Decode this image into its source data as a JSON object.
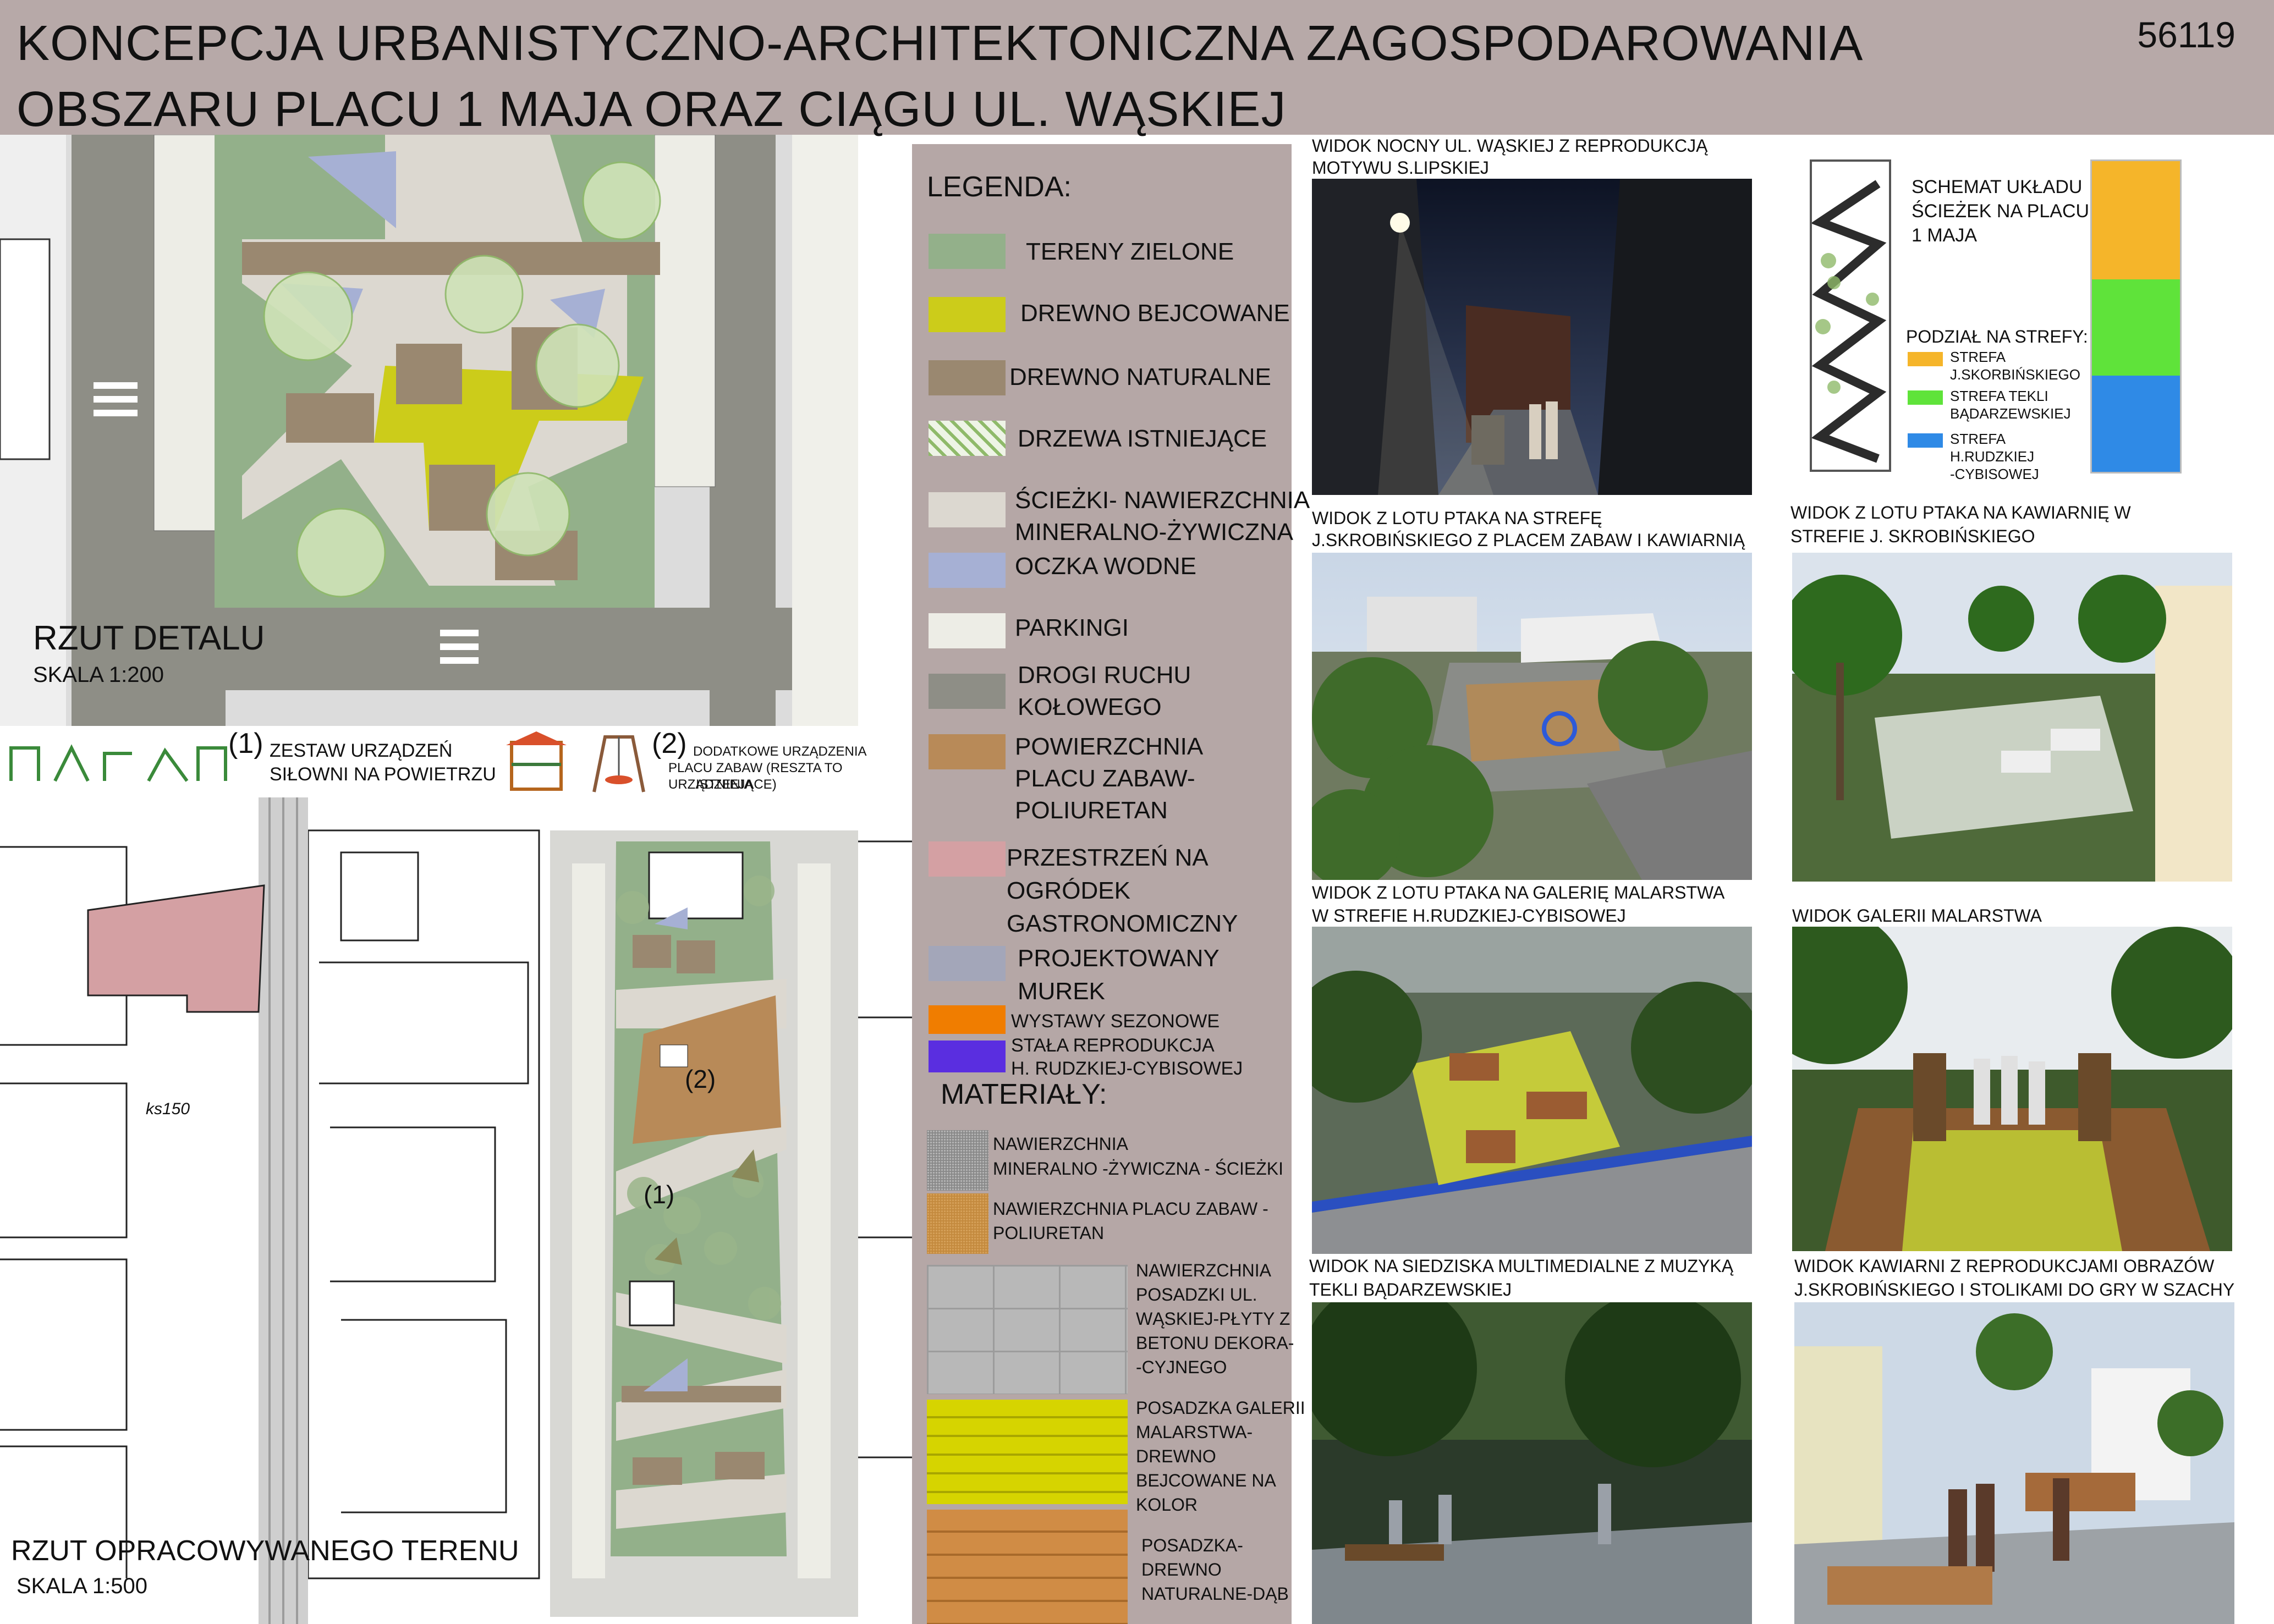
{
  "header": {
    "title_line1": "KONCEPCJA URBANISTYCZNO-ARCHITEKTONICZNA ZAGOSPODAROWANIA",
    "title_line2": "OBSZARU PLACU 1 MAJA ORAZ CIĄGU UL. WĄSKIEJ",
    "sheet_number": "56119"
  },
  "detail_plan": {
    "title": "RZUT DETALU",
    "scale": "SKALA 1:200"
  },
  "site_plan": {
    "title": "RZUT OPRACOWYWANEGO TERENU",
    "scale": "SKALA 1:500",
    "label_ks": "ks150"
  },
  "equipment": {
    "item1_num": "(1)",
    "item1_text_a": "ZESTAW URZĄDZEŃ",
    "item1_text_b": "SIŁOWNI NA POWIETRZU",
    "item2_num": "(2)",
    "item2_text_a": "DODATKOWE URZĄDZENIA",
    "item2_text_b": "PLACU ZABAW (RESZTA TO URZĄDZENIA",
    "item2_text_c": "ISTNIEJĄCE)"
  },
  "plan_markers": {
    "m1": "(1)",
    "m2": "(2)"
  },
  "legend": {
    "title": "LEGENDA:",
    "items": [
      {
        "label": "TERENY ZIELONE",
        "color": "#93b08a"
      },
      {
        "label": "DREWNO BEJCOWANE",
        "color": "#cccc1a"
      },
      {
        "label": "DREWNO NATURALNE",
        "color": "#9a8870"
      },
      {
        "label": "DRZEWA ISTNIEJĄCE",
        "color": "#8fba6a"
      },
      {
        "label": "ŚCIEŻKI- NAWIERZCHNIA",
        "label2": "MINERALNO-ŻYWICZNA",
        "color": "#dcd8d0"
      },
      {
        "label": "OCZKA WODNE",
        "color": "#a6b0d4"
      },
      {
        "label": "PARKINGI",
        "color": "#ededE6"
      },
      {
        "label": "DROGI RUCHU",
        "label2": "KOŁOWEGO",
        "color": "#8e8e86"
      },
      {
        "label": "POWIERZCHNIA",
        "label2": "PLACU ZABAW-",
        "label3": "POLIURETAN",
        "color": "#b88a58"
      },
      {
        "label": "PRZESTRZEŃ NA",
        "label2": "OGRÓDEK",
        "label3": "GASTRONOMICZNY",
        "color": "#d4a0a3"
      },
      {
        "label": "PROJEKTOWANY",
        "label2": "MUREK",
        "color": "#a3a6b9"
      },
      {
        "label": "WYSTAWY SEZONOWE",
        "color": "#f07d00"
      },
      {
        "label": "STAŁA REPRODUKCJA",
        "label2": "H. RUDZKIEJ-CYBISOWEJ",
        "color": "#5a2ee0"
      }
    ]
  },
  "materials": {
    "title": "MATERIAŁY:",
    "items": [
      {
        "label": "NAWIERZCHNIA",
        "label2": "MINERALNO -ŻYWICZNA - ŚCIEŻKI"
      },
      {
        "label": "NAWIERZCHNIA PLACU ZABAW -",
        "label2": "POLIURETAN"
      },
      {
        "label": "NAWIERZCHNIA",
        "label2": "POSADZKI UL.",
        "label3": "WĄSKIEJ-PŁYTY Z",
        "label4": "BETONU DEKORA-",
        "label5": "-CYJNEGO"
      },
      {
        "label": "POSADZKA GALERII",
        "label2": "MALARSTWA-",
        "label3": "DREWNO",
        "label4": "BEJCOWANE NA",
        "label5": "KOLOR"
      },
      {
        "label": "POSADZKA-",
        "label2": "DREWNO",
        "label3": "NATURALNE-DĄB"
      }
    ]
  },
  "views": {
    "v1_a": "WIDOK NOCNY UL. WĄSKIEJ Z REPRODUKCJĄ",
    "v1_b": "MOTYWU S.LIPSKIEJ",
    "v2_a": "WIDOK Z LOTU PTAKA NA STREFĘ",
    "v2_b": "J.SKROBIŃSKIEGO Z PLACEM ZABAW I KAWIARNIĄ",
    "v3_a": "WIDOK Z LOTU PTAKA NA KAWIARNIĘ W",
    "v3_b": "STREFIE J. SKROBIŃSKIEGO",
    "v4_a": "WIDOK Z LOTU PTAKA NA GALERIĘ MALARSTWA",
    "v4_b": "W STREFIE H.RUDZKIEJ-CYBISOWEJ",
    "v5": "WIDOK GALERII MALARSTWA",
    "v6_a": "WIDOK NA SIEDZISKA MULTIMEDIALNE Z MUZYKĄ",
    "v6_b": "TEKLI BĄDARZEWSKIEJ",
    "v7_a": "WIDOK KAWIARNI Z REPRODUKCJAMI OBRAZÓW",
    "v7_b": "J.SKROBIŃSKIEGO I STOLIKAMI DO GRY W SZACHY"
  },
  "schema": {
    "title_a": "SCHEMAT UKŁADU",
    "title_b": "ŚCIEŻEK NA PLACU",
    "title_c": "1 MAJA",
    "zones_title": "PODZIAŁ NA STREFY:",
    "zones": [
      {
        "label": "STREFA",
        "label2": "J.SKORBIŃSKIEGO",
        "color": "#f5b52a"
      },
      {
        "label": "STREFA TEKLI",
        "label2": "BĄDARZEWSKIEJ",
        "color": "#5fe33a"
      },
      {
        "label": "STREFA",
        "label2": "H.RUDZKIEJ",
        "label3": "-CYBISOWEJ",
        "color": "#2f8ae6"
      }
    ]
  }
}
